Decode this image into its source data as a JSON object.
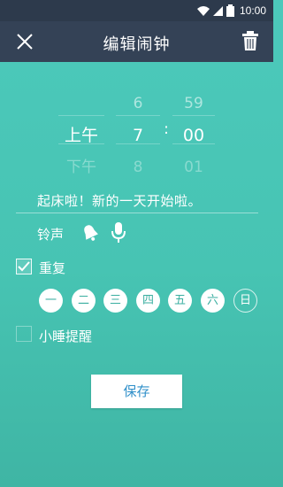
{
  "status_bar": {
    "time": "10:00"
  },
  "app_bar": {
    "title": "编辑闹钟"
  },
  "picker": {
    "ampm": {
      "prev": "",
      "selected": "上午",
      "next": "下午"
    },
    "hour": {
      "prev": "6",
      "selected": "7",
      "next": "8"
    },
    "separator": ":",
    "minute": {
      "prev": "59",
      "selected": "00",
      "next": "01"
    }
  },
  "message": "起床啦！新的一天开始啦。",
  "ringtone": {
    "label": "铃声"
  },
  "repeat": {
    "label": "重复",
    "checked": true,
    "days": [
      {
        "label": "一",
        "on": true
      },
      {
        "label": "二",
        "on": true
      },
      {
        "label": "三",
        "on": true
      },
      {
        "label": "四",
        "on": true
      },
      {
        "label": "五",
        "on": true
      },
      {
        "label": "六",
        "on": true
      },
      {
        "label": "日",
        "on": false
      }
    ]
  },
  "snooze": {
    "label": "小睡提醒",
    "checked": false
  },
  "save_label": "保存",
  "colors": {
    "background": "#47c4b3",
    "app_bar": "#344256",
    "status_bar": "#2d3a4c",
    "save_text": "#2f8fc9"
  }
}
